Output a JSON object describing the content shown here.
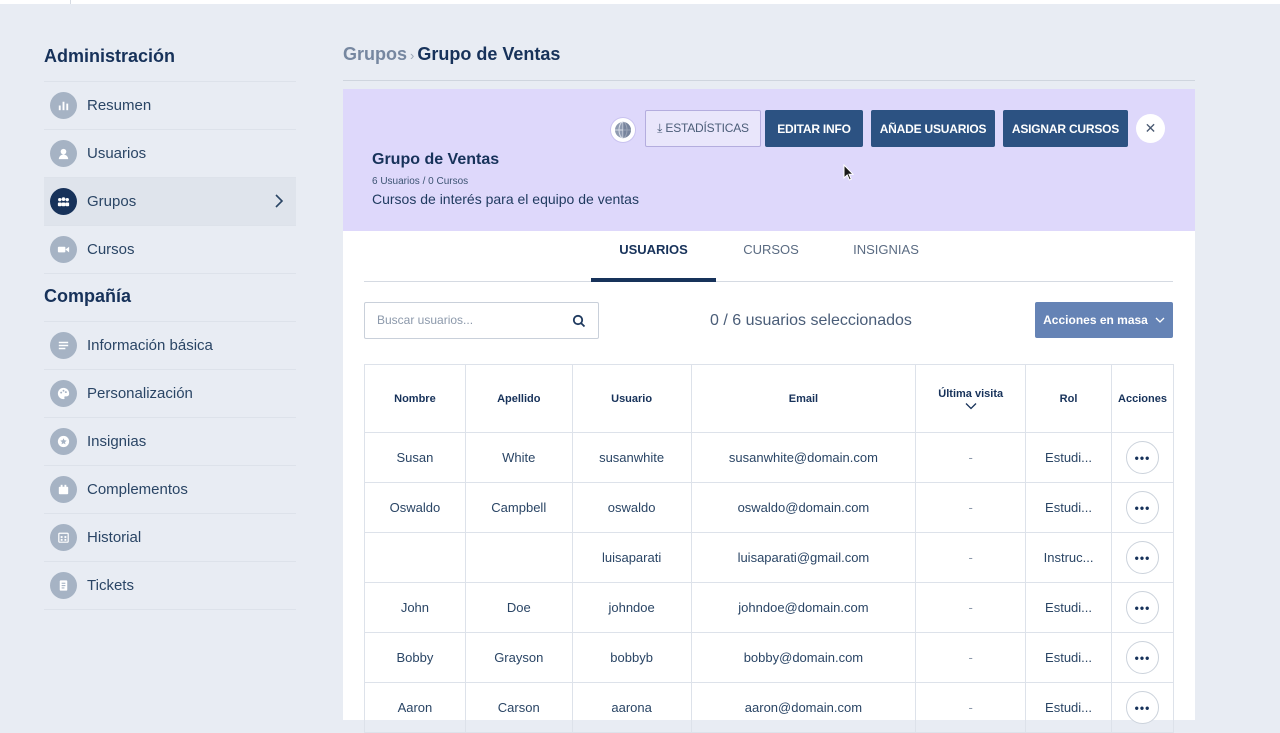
{
  "sidebar": {
    "admin_heading": "Administración",
    "admin_items": [
      {
        "label": "Resumen",
        "icon": "chart-icon"
      },
      {
        "label": "Usuarios",
        "icon": "user-icon"
      },
      {
        "label": "Grupos",
        "icon": "group-icon"
      },
      {
        "label": "Cursos",
        "icon": "video-icon"
      }
    ],
    "company_heading": "Compañía",
    "company_items": [
      {
        "label": "Información básica",
        "icon": "list-icon"
      },
      {
        "label": "Personalización",
        "icon": "palette-icon"
      },
      {
        "label": "Insignias",
        "icon": "badge-star-icon"
      },
      {
        "label": "Complementos",
        "icon": "plugin-icon"
      },
      {
        "label": "Historial",
        "icon": "calendar-icon"
      },
      {
        "label": "Tickets",
        "icon": "ticket-icon"
      }
    ]
  },
  "breadcrumb": {
    "parent": "Grupos",
    "separator": "›",
    "current": "Grupo de Ventas"
  },
  "group": {
    "title": "Grupo de Ventas",
    "meta": "6 Usuarios / 0 Cursos",
    "description": "Cursos de interés para el equipo de ventas",
    "buttons": {
      "stats": "⤓ ESTADÍSTICAS",
      "edit": "EDITAR INFO",
      "add_users": "AÑADE USUARIOS",
      "assign_courses": "ASIGNAR CURSOS",
      "close": "✕"
    }
  },
  "tabs": {
    "users": "USUARIOS",
    "courses": "CURSOS",
    "badges": "INSIGNIAS"
  },
  "search": {
    "placeholder": "Buscar usuarios..."
  },
  "selection": {
    "text": "0 / 6 usuarios seleccionados"
  },
  "bulk_actions": {
    "label": "Acciones en masa"
  },
  "table": {
    "headers": {
      "first_name": "Nombre",
      "last_name": "Apellido",
      "username": "Usuario",
      "email": "Email",
      "last_visit": "Última visita",
      "role": "Rol",
      "actions": "Acciones"
    },
    "more_label": "•••",
    "rows": [
      {
        "first_name": "Susan",
        "last_name": "White",
        "username": "susanwhite",
        "email": "susanwhite@domain.com",
        "last_visit": "-",
        "role": "Estudi..."
      },
      {
        "first_name": "Oswaldo",
        "last_name": "Campbell",
        "username": "oswaldo",
        "email": "oswaldo@domain.com",
        "last_visit": "-",
        "role": "Estudi..."
      },
      {
        "first_name": "",
        "last_name": "",
        "username": "luisaparati",
        "email": "luisaparati@gmail.com",
        "last_visit": "-",
        "role": "Instruc..."
      },
      {
        "first_name": "John",
        "last_name": "Doe",
        "username": "johndoe",
        "email": "johndoe@domain.com",
        "last_visit": "-",
        "role": "Estudi..."
      },
      {
        "first_name": "Bobby",
        "last_name": "Grayson",
        "username": "bobbyb",
        "email": "bobby@domain.com",
        "last_visit": "-",
        "role": "Estudi..."
      },
      {
        "first_name": "Aaron",
        "last_name": "Carson",
        "username": "aarona",
        "email": "aaron@domain.com",
        "last_visit": "-",
        "role": "Estudi..."
      }
    ]
  },
  "colors": {
    "primary": "#2c5282",
    "banner": "#ded8fb",
    "navy": "#17325a",
    "bulk": "#6583b5"
  }
}
